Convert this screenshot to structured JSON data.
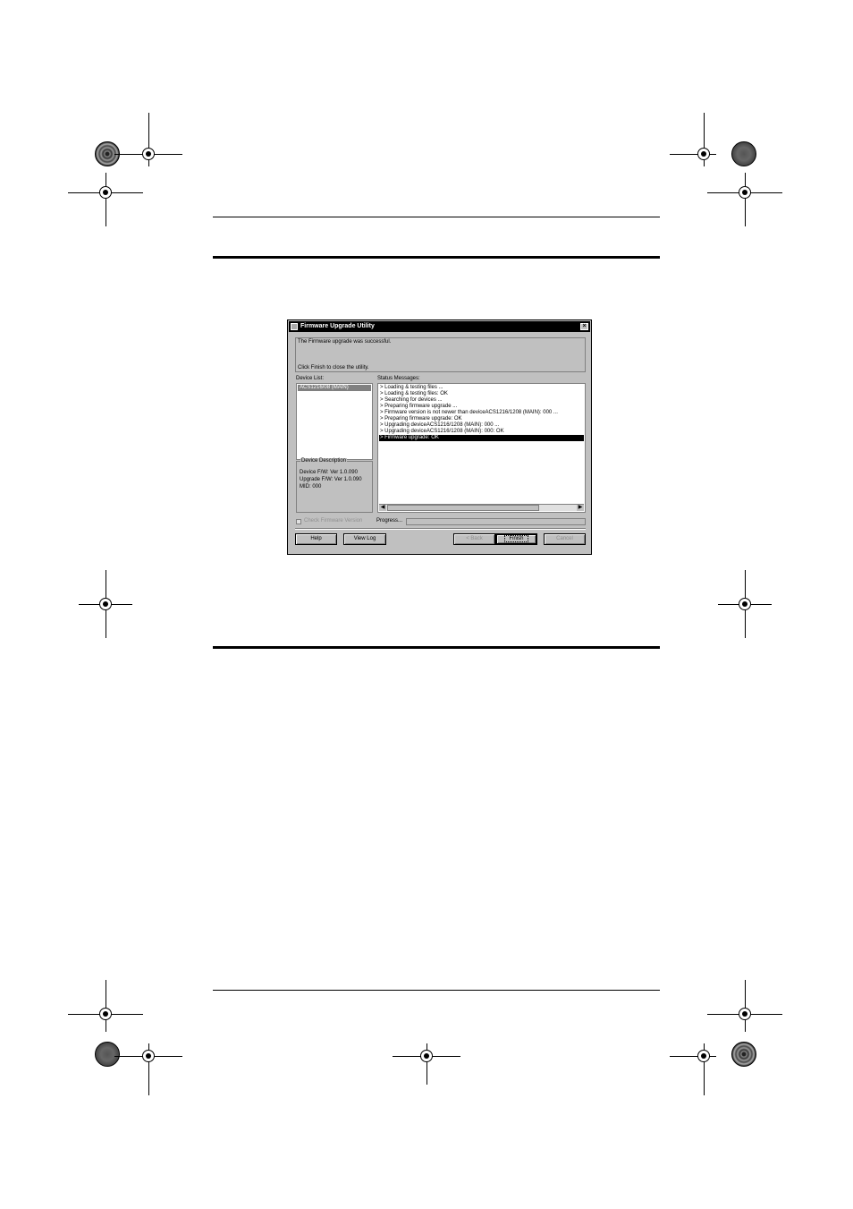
{
  "dialog": {
    "title": "Firmware Upgrade Utility",
    "close_glyph": "×",
    "message_line1": "The Firmware upgrade was successful.",
    "message_line2": "Click Finish to close the utility.",
    "device_list_label": "Device List:",
    "device_item": "ACS1216/08 (MAIN)",
    "status_label": "Status Messages:",
    "status_messages": [
      "> Loading & testing files ...",
      "> Loading & testing files: OK",
      "> Searching for devices ...",
      "> Preparing firmware upgrade ...",
      "> Firmware version is not newer than deviceACS1216/1208 (MAIN): 000 ...",
      "> Preparing firmware upgrade: OK",
      "> Upgrading deviceACS1216/1208 (MAIN): 000 ...",
      "> Upgrading deviceACS1216/1208 (MAIN): 000: OK",
      "> Firmware upgrade: OK"
    ],
    "selected_message_index": 8,
    "description_label": "Device Description",
    "device_fw": "Device F/W: Ver 1.0.090",
    "upgrade_fw": "Upgrade F/W: Ver 1.0.090",
    "mid": "MID: 000",
    "check_label": "Check Firmware Version",
    "progress_label": "Progress...",
    "buttons": {
      "help": "Help",
      "view_log": "View Log",
      "back": "< Back",
      "finish": "Finish",
      "cancel": "Cancel"
    }
  },
  "colors": {
    "dialog_bg": "#c0c0c0",
    "titlebar": "#000000",
    "selection": "#000000"
  }
}
